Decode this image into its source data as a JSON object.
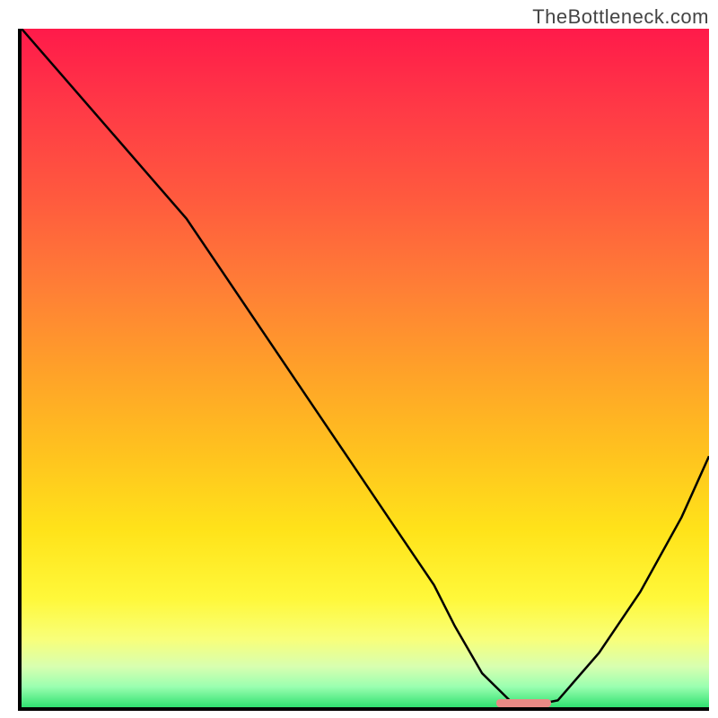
{
  "watermark": "TheBottleneck.com",
  "chart_data": {
    "type": "line",
    "title": "",
    "xlabel": "",
    "ylabel": "",
    "xlim": [
      0,
      100
    ],
    "ylim": [
      0,
      100
    ],
    "grid": false,
    "legend": false,
    "background": "rainbow-vertical-gradient",
    "series": [
      {
        "name": "bottleneck-curve",
        "x": [
          0,
          6,
          12,
          18,
          24,
          30,
          36,
          42,
          48,
          54,
          60,
          63,
          67,
          71,
          73,
          78,
          84,
          90,
          96,
          100
        ],
        "y": [
          100,
          93,
          86,
          79,
          72,
          63,
          54,
          45,
          36,
          27,
          18,
          12,
          5,
          1,
          0,
          1,
          8,
          17,
          28,
          37
        ]
      }
    ],
    "optimal_marker": {
      "x_start": 69,
      "x_end": 77,
      "y": 0
    },
    "gradient_stops": [
      {
        "pos": 0.0,
        "color": "#ff1a4a"
      },
      {
        "pos": 0.12,
        "color": "#ff3a46"
      },
      {
        "pos": 0.25,
        "color": "#ff5a3e"
      },
      {
        "pos": 0.38,
        "color": "#ff7e36"
      },
      {
        "pos": 0.5,
        "color": "#ffa029"
      },
      {
        "pos": 0.62,
        "color": "#ffc11f"
      },
      {
        "pos": 0.74,
        "color": "#ffe31a"
      },
      {
        "pos": 0.84,
        "color": "#fff83a"
      },
      {
        "pos": 0.9,
        "color": "#f8ff7a"
      },
      {
        "pos": 0.94,
        "color": "#d8ffb0"
      },
      {
        "pos": 0.97,
        "color": "#9affb0"
      },
      {
        "pos": 1.0,
        "color": "#30e070"
      }
    ]
  }
}
